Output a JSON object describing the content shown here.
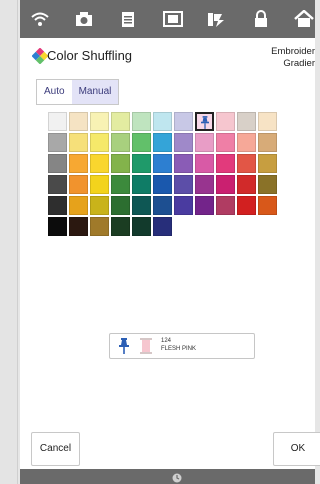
{
  "header": {
    "title": "Color Shuffling",
    "subtitle_line1": "Embroider",
    "subtitle_line2": "Gradier",
    "toolbar_icons": [
      "wifi-icon",
      "camera-icon",
      "document-icon",
      "help-icon",
      "thread-change-icon",
      "lock-icon",
      "home-icon"
    ]
  },
  "mode_tabs": [
    {
      "label": "Auto",
      "selected": false
    },
    {
      "label": "Manual",
      "selected": true
    }
  ],
  "palette": {
    "selected_index": 7,
    "rows": [
      [
        "#f1f1f1",
        "#f5e3c3",
        "#f8f2b4",
        "#e3eca1",
        "#bfe4bf",
        "#bfe6ef",
        "#c8c8e6",
        "#f7d8e8",
        "#f6c6cf",
        "#d8d0c8",
        "#f7e3c5"
      ],
      [
        "#a8a8a8",
        "#f6e07a",
        "#f5e96a",
        "#a8d07e",
        "#62c06a",
        "#34a4d8",
        "#9f89c9",
        "#e89dc6",
        "#ef7fa6",
        "#f6a898",
        "#d7ab78"
      ],
      [
        "#858585",
        "#f7a832",
        "#f9d62e",
        "#83b34b",
        "#1f9a6a",
        "#2d7fd1",
        "#8a5cb6",
        "#d85aa6",
        "#e23a7c",
        "#e25646",
        "#c79e40"
      ],
      [
        "#4a4a4a",
        "#f1932d",
        "#f3d31c",
        "#3c8a3c",
        "#0f7c66",
        "#1a58ad",
        "#5c4ea8",
        "#98348f",
        "#ca2070",
        "#d12a2a",
        "#8a7228"
      ],
      [
        "#2e2e2e",
        "#e6a21b",
        "#c9b31a",
        "#2c6e30",
        "#0e5754",
        "#1d4f91",
        "#4a3ba0",
        "#73248a",
        "#b03c62",
        "#d22020",
        "#d8581a"
      ],
      [
        "#0c0c0c",
        "#2b1810",
        "#a07a2a",
        "#1b3d22",
        "#123a2c",
        "#272e7a"
      ]
    ]
  },
  "thread_info": {
    "number": "124",
    "name": "FLESH PINK"
  },
  "buttons": {
    "cancel": "Cancel",
    "ok": "OK"
  }
}
